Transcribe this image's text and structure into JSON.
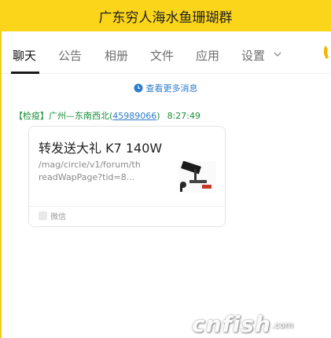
{
  "window": {
    "title": "广东穷人海水鱼珊瑚群"
  },
  "tabs": [
    {
      "label": "聊天",
      "active": true
    },
    {
      "label": "公告"
    },
    {
      "label": "相册"
    },
    {
      "label": "文件"
    },
    {
      "label": "应用"
    },
    {
      "label": "设置"
    }
  ],
  "chat": {
    "more_messages": "查看更多消息",
    "message": {
      "sender_name": "【检疫】广州—东南西北",
      "sender_qq": "45989066",
      "time": "8:27:49",
      "card": {
        "title": "转发送大礼 K7 140W",
        "description": "/mag/circle/v1/forum/threadWapPage?tid=8...",
        "source": "微信"
      }
    }
  },
  "watermark": {
    "brand": "cnfish",
    "suffix": ".com"
  },
  "colors": {
    "accent_yellow": "#fbd51a",
    "link_blue": "#2d7bcc",
    "sender_green": "#1a8f3a"
  },
  "icons": [
    "chevron-down-icon",
    "phone-call-icon",
    "clock-icon",
    "thumbnail-image",
    "wechat-icon"
  ]
}
